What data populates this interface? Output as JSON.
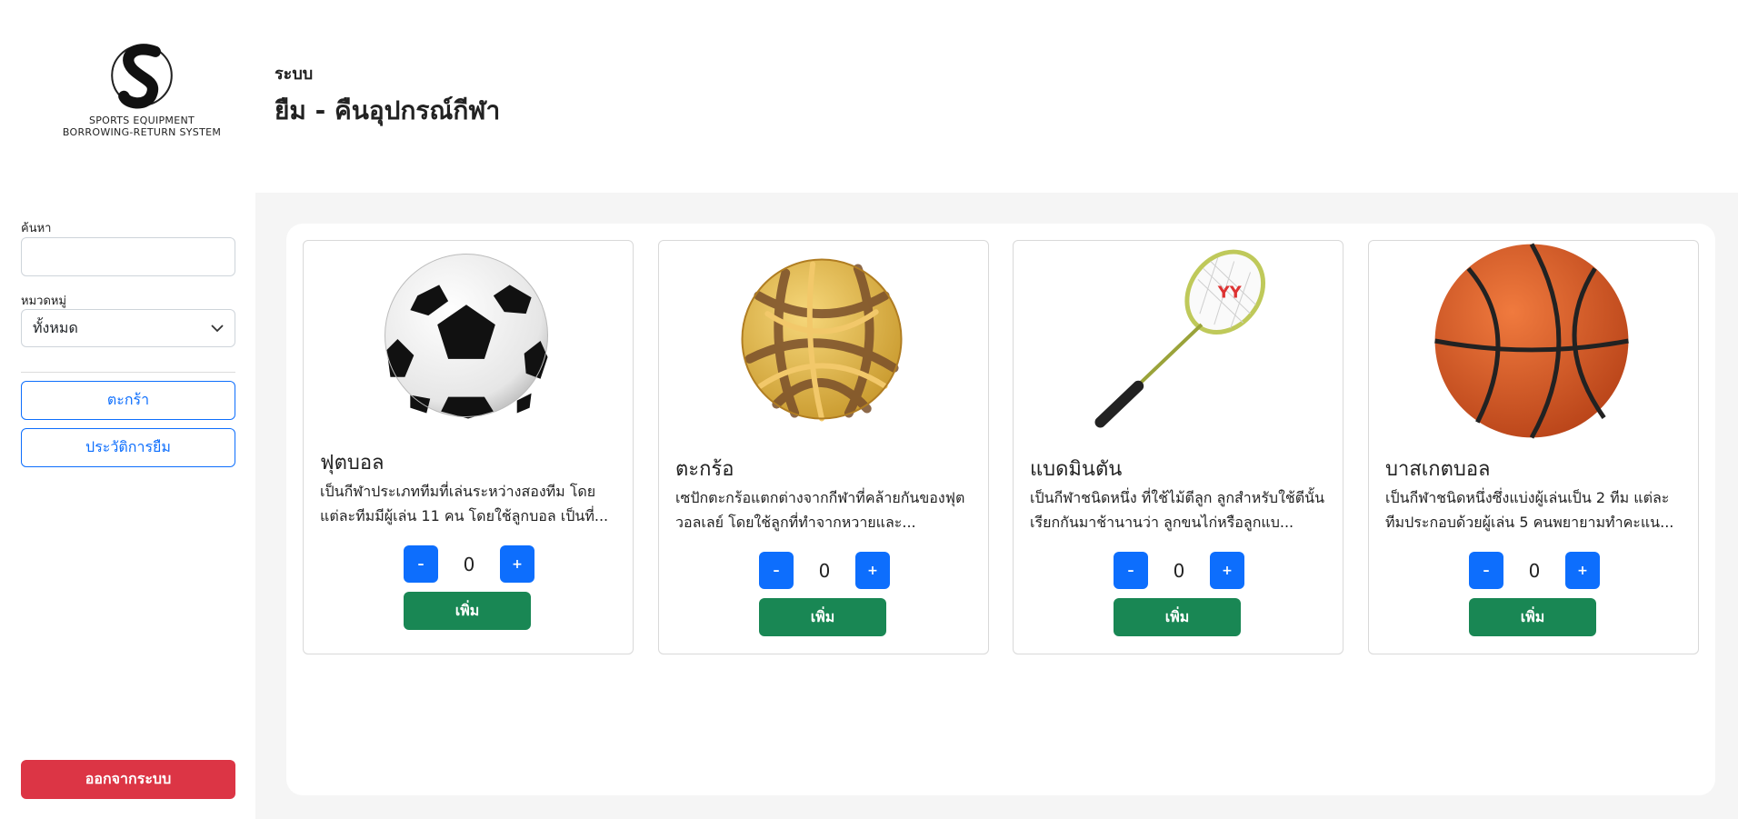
{
  "brand": {
    "line1": "SPORTS EQUIPMENT",
    "line2": "BORROWING-RETURN SYSTEM"
  },
  "header": {
    "subtitle": "ระบบ",
    "title": "ยืม - คืนอุปกรณ์กีฬา"
  },
  "sidebar": {
    "search_label": "ค้นหา",
    "search_value": "",
    "category_label": "หมวดหมู่",
    "category_selected": "ทั้งหมด",
    "cart_label": "ตะกร้า",
    "history_label": "ประวัติการยืม",
    "logout_label": "ออกจากระบบ"
  },
  "items": [
    {
      "name": "ฟุตบอล",
      "description": "เป็นกีฬาประเภททีมที่เล่นระหว่างสองทีม โดยแต่ละทีมมีผู้เล่น 11 คน โดยใช้ลูกบอล เป็นที่...",
      "quantity": "0",
      "minus": "–",
      "plus": "+",
      "add_label": "เพิ่ม",
      "image_icon": "soccer-ball-icon"
    },
    {
      "name": "ตะกร้อ",
      "description": "เซปักตะกร้อแตกต่างจากกีฬาที่คล้ายกันของฟุตวอลเลย์ โดยใช้ลูกที่ทำจากหวายและ...",
      "quantity": "0",
      "minus": "–",
      "plus": "+",
      "add_label": "เพิ่ม",
      "image_icon": "takraw-ball-icon"
    },
    {
      "name": "แบดมินตัน",
      "description": "เป็นกีฬาชนิดหนึ่ง ที่ใช้ไม้ตีลูก ลูกสำหรับใช้ตีนั้น เรียกกันมาช้านานว่า ลูกขนไก่หรือลูกแบ...",
      "quantity": "0",
      "minus": "–",
      "plus": "+",
      "add_label": "เพิ่ม",
      "image_icon": "badminton-racket-icon"
    },
    {
      "name": "บาสเกตบอล",
      "description": "เป็นกีฬาชนิดหนึ่งซึ่งแบ่งผู้เล่นเป็น 2 ทีม แต่ละทีมประกอบด้วยผู้เล่น 5 คนพยายามทำคะแน...",
      "quantity": "0",
      "minus": "–",
      "plus": "+",
      "add_label": "เพิ่ม",
      "image_icon": "basketball-icon"
    }
  ],
  "colors": {
    "primary": "#0d6efd",
    "success": "#198754",
    "danger": "#dc3545",
    "background": "#f5f5f5"
  }
}
